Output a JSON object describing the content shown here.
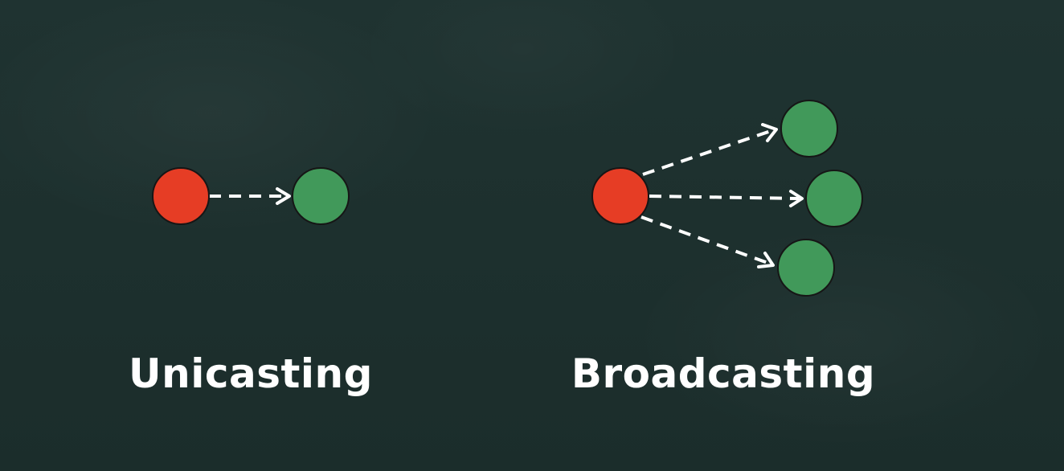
{
  "captions": {
    "unicasting": "Unicasting",
    "broadcasting": "Broadcasting"
  },
  "colors": {
    "background": "#1d302e",
    "sender": "#e63d25",
    "receiver": "#41995a",
    "arrow": "#ffffff",
    "text": "#ffffff"
  },
  "diagrams": {
    "unicasting": {
      "senders": 1,
      "receivers": 1,
      "arrow_style": "dashed"
    },
    "broadcasting": {
      "senders": 1,
      "receivers": 3,
      "arrow_style": "dashed"
    }
  }
}
